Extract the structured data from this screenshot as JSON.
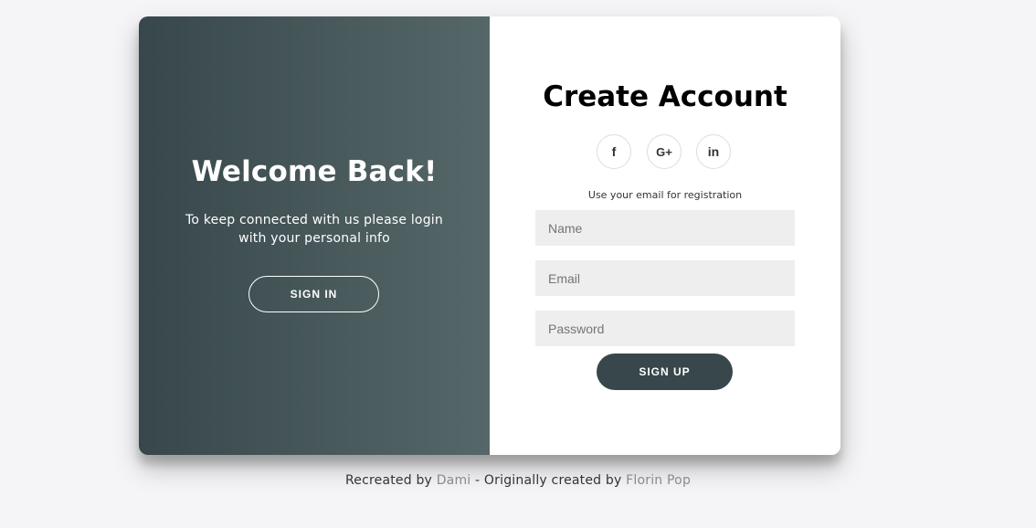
{
  "overlay": {
    "title": "Welcome Back!",
    "text": "To keep connected with us please login with your personal info",
    "button_label": "SIGN IN"
  },
  "form": {
    "title": "Create Account",
    "social": [
      {
        "glyph": "f",
        "icon": "facebook-icon"
      },
      {
        "glyph": "G+",
        "icon": "google-plus-icon"
      },
      {
        "glyph": "in",
        "icon": "linkedin-icon"
      }
    ],
    "hint": "Use your email for registration",
    "fields": {
      "name": {
        "placeholder": "Name",
        "value": ""
      },
      "email": {
        "placeholder": "Email",
        "value": ""
      },
      "password": {
        "placeholder": "Password",
        "value": ""
      }
    },
    "button_label": "SIGN UP"
  },
  "footer": {
    "prefix": "Recreated by",
    "author_link": "Dami",
    "separator": "- Originally created by",
    "original_link": "Florin Pop"
  },
  "colors": {
    "accent": "#37474b",
    "gradient_end": "#566769",
    "input_bg": "#eeeeee",
    "page_bg": "#f5f5f7"
  }
}
